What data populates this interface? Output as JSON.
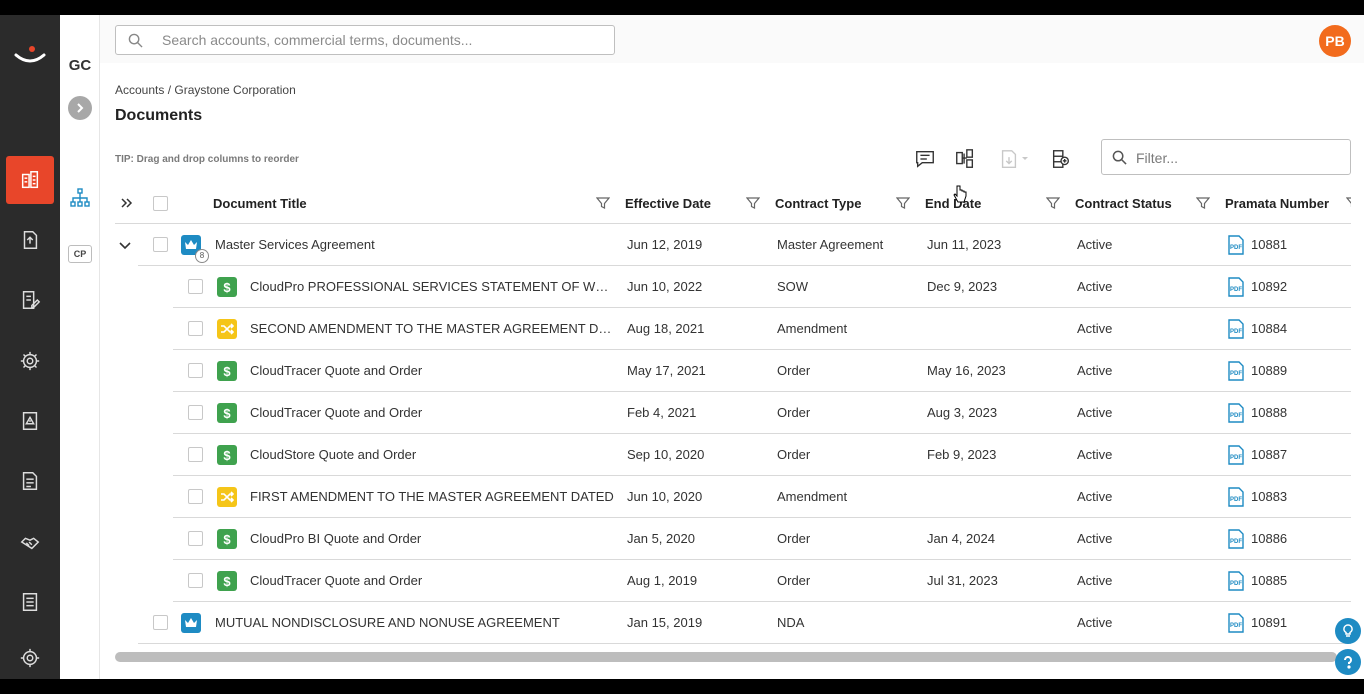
{
  "sidebar": {
    "org_code": "GC",
    "cp_label": "CP"
  },
  "search": {
    "placeholder": "Search accounts, commercial terms, documents..."
  },
  "user": {
    "initials": "PB"
  },
  "breadcrumb": "Accounts / Graystone Corporation",
  "page_title": "Documents",
  "tip": "TIP: Drag and drop columns to reorder",
  "filter": {
    "placeholder": "Filter..."
  },
  "columns": {
    "title": "Document Title",
    "effective": "Effective Date",
    "type": "Contract Type",
    "end": "End Date",
    "status": "Contract Status",
    "number": "Pramata Number"
  },
  "rows": [
    {
      "title": "Master Services Agreement",
      "effective": "Jun 12, 2019",
      "type": "Master Agreement",
      "end": "Jun 11, 2023",
      "status": "Active",
      "number": "10881",
      "icon": "crown-icon",
      "badge": "8"
    },
    {
      "title": "CloudPro PROFESSIONAL SERVICES STATEMENT OF WORK",
      "effective": "Jun 10, 2022",
      "type": "SOW",
      "end": "Dec 9, 2023",
      "status": "Active",
      "number": "10892",
      "icon": "dollar-icon"
    },
    {
      "title": "SECOND AMENDMENT TO THE MASTER AGREEMENT DATED",
      "effective": "Aug 18, 2021",
      "type": "Amendment",
      "end": "",
      "status": "Active",
      "number": "10884",
      "icon": "shuffle-icon"
    },
    {
      "title": "CloudTracer Quote and Order",
      "effective": "May 17, 2021",
      "type": "Order",
      "end": "May 16, 2023",
      "status": "Active",
      "number": "10889",
      "icon": "dollar-icon"
    },
    {
      "title": "CloudTracer Quote and Order",
      "effective": "Feb 4, 2021",
      "type": "Order",
      "end": "Aug 3, 2023",
      "status": "Active",
      "number": "10888",
      "icon": "dollar-icon"
    },
    {
      "title": "CloudStore Quote and Order",
      "effective": "Sep 10, 2020",
      "type": "Order",
      "end": "Feb 9, 2023",
      "status": "Active",
      "number": "10887",
      "icon": "dollar-icon"
    },
    {
      "title": "FIRST AMENDMENT TO THE MASTER AGREEMENT DATED",
      "effective": "Jun 10, 2020",
      "type": "Amendment",
      "end": "",
      "status": "Active",
      "number": "10883",
      "icon": "shuffle-icon"
    },
    {
      "title": "CloudPro BI Quote and Order",
      "effective": "Jan 5, 2020",
      "type": "Order",
      "end": "Jan 4, 2024",
      "status": "Active",
      "number": "10886",
      "icon": "dollar-icon"
    },
    {
      "title": "CloudTracer Quote and Order",
      "effective": "Aug 1, 2019",
      "type": "Order",
      "end": "Jul 31, 2023",
      "status": "Active",
      "number": "10885",
      "icon": "dollar-icon"
    },
    {
      "title": "MUTUAL NONDISCLOSURE AND NONUSE AGREEMENT",
      "effective": "Jan 15, 2019",
      "type": "NDA",
      "end": "",
      "status": "Active",
      "number": "10891",
      "icon": "crown-icon"
    }
  ],
  "colors": {
    "accent": "#e8462a",
    "nav_bg": "#2b2b2b",
    "sow_green": "#3fa24e",
    "amend_yellow": "#f5c518",
    "master_blue": "#1e8bc3",
    "avatar_orange": "#f26b1d"
  }
}
